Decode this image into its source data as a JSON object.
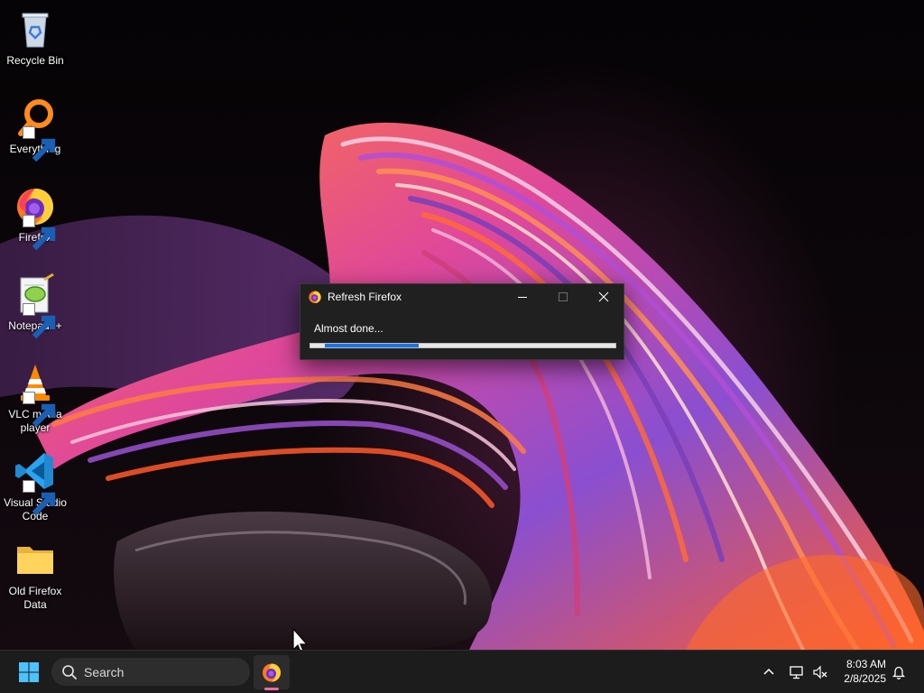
{
  "desktop": {
    "icons": [
      {
        "label": "Recycle Bin",
        "icon": "recycle-bin-icon"
      },
      {
        "label": "Everything",
        "icon": "everything-search-icon"
      },
      {
        "label": "Firefox",
        "icon": "firefox-icon"
      },
      {
        "label": "Notepad++",
        "icon": "notepad-plus-plus-icon"
      },
      {
        "label": "VLC media player",
        "icon": "vlc-icon"
      },
      {
        "label": "Visual Studio Code",
        "icon": "vscode-icon"
      },
      {
        "label": "Old Firefox Data",
        "icon": "folder-icon"
      }
    ]
  },
  "dialog": {
    "title": "Refresh Firefox",
    "message": "Almost done...",
    "progress": 0.34,
    "app_icon": "firefox-icon"
  },
  "taskbar": {
    "search_label": "Search",
    "clock_time": "8:03 AM",
    "clock_date": "2/8/2025",
    "active_app": "firefox-icon"
  },
  "colors": {
    "progress_fill": "#1a73e8",
    "taskbar_bg": "#1c1c1c",
    "dialog_bg": "#202020",
    "active_indicator": "#f06aa0"
  }
}
